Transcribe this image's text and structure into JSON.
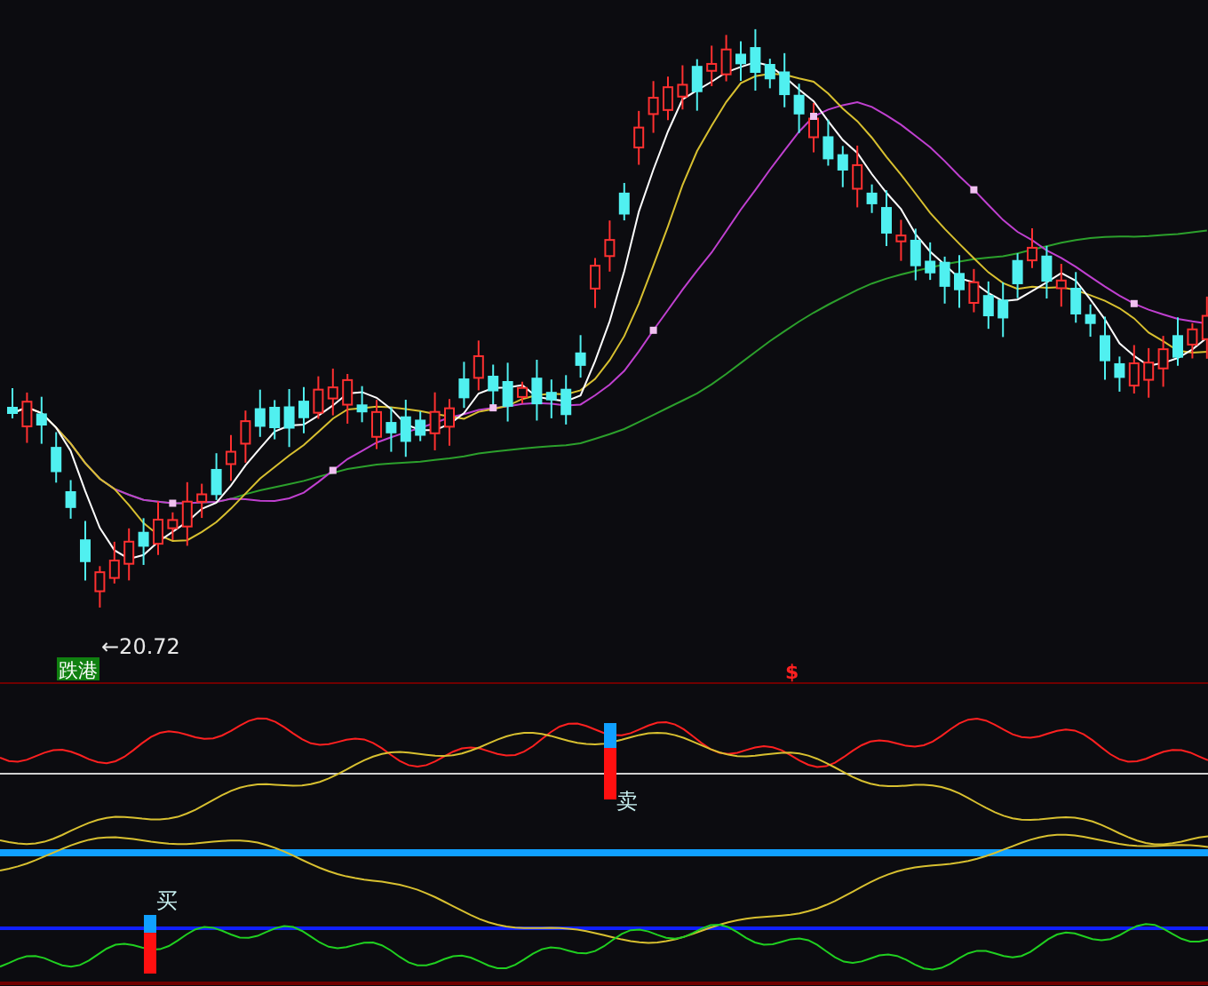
{
  "price_chart": {
    "low_label": "←20.72",
    "signal_tag": "跌港"
  },
  "divider_marker": "$",
  "indicator_panel": {
    "signal": "卖"
  },
  "lower_panel": {
    "signal": "买"
  }
}
